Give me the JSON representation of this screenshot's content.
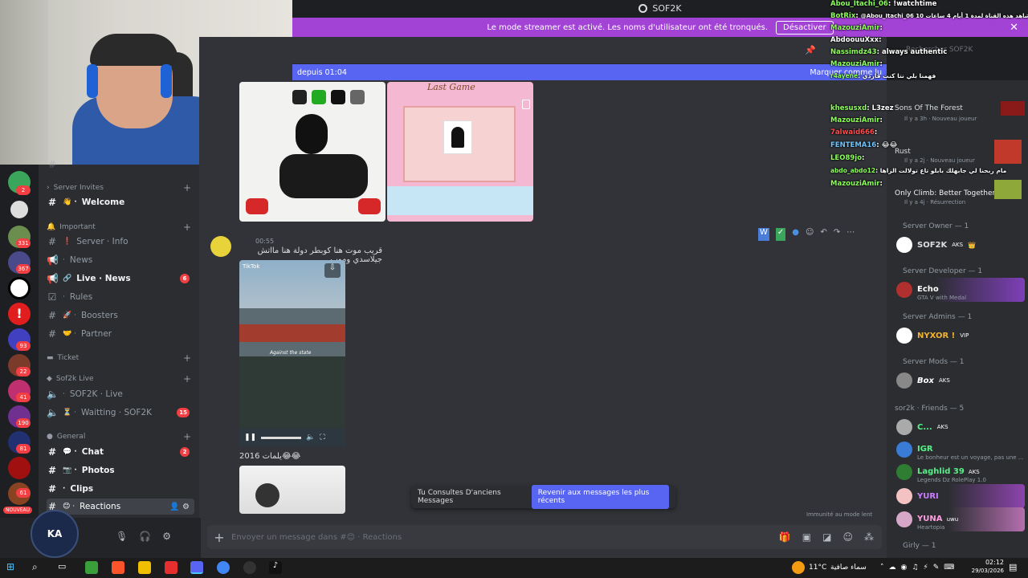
{
  "window": {
    "title": "SOF2K"
  },
  "streamer_banner": {
    "text": "Le mode streamer est activé. Les noms d'utilisateur ont été tronqués.",
    "button": "Désactiver"
  },
  "new_messages_bar": {
    "left": "depuis 01:04",
    "right": "Marquer comme lu"
  },
  "server_badges": [
    "2",
    "331",
    "367",
    "93",
    "22",
    "41",
    "190",
    "81",
    "61",
    "NOUVEAU"
  ],
  "channels": {
    "categories": [
      {
        "label": "Server Invites"
      },
      {
        "label": "Important"
      },
      {
        "label": "Ticket"
      },
      {
        "label": "Sof2k Live"
      },
      {
        "label": "General"
      }
    ],
    "items": [
      {
        "label": "Welcome"
      },
      {
        "label": "Server · Info"
      },
      {
        "label": "News"
      },
      {
        "label": "Live · News",
        "badge": "6"
      },
      {
        "label": "Rules"
      },
      {
        "label": "Boosters"
      },
      {
        "label": "Partner"
      },
      {
        "label": "SOF2K · Live"
      },
      {
        "label": "Waitting · SOF2K",
        "badge": "15"
      },
      {
        "label": "Chat",
        "badge": "2"
      },
      {
        "label": "Photos"
      },
      {
        "label": "Clips"
      },
      {
        "label": "Reactions"
      }
    ]
  },
  "messages": [
    {
      "time": "00:55",
      "text": "قريب موت هنا كوبطر دولة هنا مااتش جيلاسدي وموب"
    },
    {
      "video_label": "TikTok",
      "video_caption": "Against the state"
    },
    {
      "text": "يلمات 2016😂😂"
    }
  ],
  "game_card": {
    "title": "Last Game"
  },
  "jump_pill": {
    "text": "Tu Consultes D'anciens Messages",
    "button": "Revenir aux messages les plus récents"
  },
  "composer": {
    "placeholder": "Envoyer un message dans #😊 · Reactions"
  },
  "immunity_note": "Immunité au mode lent",
  "search": {
    "placeholder": "Rechercher SOF2K"
  },
  "activity": [
    {
      "title": "Sons Of The Forest",
      "sub": "Il y a 3h · Nouveau joueur"
    },
    {
      "title": "Rust",
      "sub": "Il y a 2j · Nouveau joueur"
    },
    {
      "title": "Only Climb: Better Together",
      "sub": "Il y a 4j · Résurrection"
    }
  ],
  "members": {
    "groups": [
      {
        "label": "Server Owner — 1"
      },
      {
        "label": "Server Developer — 1"
      },
      {
        "label": "Server Admins — 1"
      },
      {
        "label": "Server Mods — 1"
      },
      {
        "label": "sor2k · Friends — 5"
      },
      {
        "label": "Girly — 1"
      }
    ],
    "list": [
      {
        "name": "SOF2K",
        "tag": "AKS",
        "status": "",
        "color": "#dbdee1"
      },
      {
        "name": "Echo",
        "tag": "",
        "status": "GTA V with Medal",
        "color": "#ffffff"
      },
      {
        "name": "NYXOR !",
        "tag": "VIP",
        "status": "",
        "color": "#f0b232"
      },
      {
        "name": "Box",
        "tag": "AKS",
        "status": "",
        "color": "#ffffff"
      },
      {
        "name": "C...",
        "tag": "AKS",
        "status": "",
        "color": "#57f287"
      },
      {
        "name": "IGR",
        "tag": "",
        "status": "Le bonheur est un voyage, pas une ...",
        "color": "#57f287"
      },
      {
        "name": "Laghlid 39",
        "tag": "AKS",
        "status": "Legends Dz RolePlay 1.0",
        "color": "#57f287"
      },
      {
        "name": "YURI",
        "tag": "",
        "status": "",
        "color": "#c97dff"
      },
      {
        "name": "YUNA",
        "tag": "uwu",
        "status": "Heartopia",
        "color": "#ff9ee0"
      }
    ]
  },
  "twitch_chat": [
    {
      "user": "Abou_Itachi_06",
      "msg": "!watchtime"
    },
    {
      "user": "BotRix",
      "msg": "@Abou_Itachi_06 شاهد هذه القناة لمدة 1 أيام 4 ساعات 10 min"
    },
    {
      "user": "MazouziAmir",
      "msg": ""
    },
    {
      "user": "AbdoouuXxx",
      "msg": ""
    },
    {
      "user": "Nassimdz43",
      "msg": "always authentic"
    },
    {
      "user": "MazouziAmir",
      "msg": ""
    },
    {
      "user": "r4ayene",
      "msg": "فهمنا بلي نتا كنت قاردي"
    },
    {
      "user": "khesusxd",
      "msg": "L3zez"
    },
    {
      "user": "MazouziAmir",
      "msg": ""
    },
    {
      "user": "7alwaid666",
      "msg": ""
    },
    {
      "user": "FENTEMA16",
      "msg": "😂😂"
    },
    {
      "user": "LEO89jo",
      "msg": ""
    },
    {
      "user": "abdo_abdo12",
      "msg": "مام ربحنا لي جابهلك بابلو تاع تولالت الزاها"
    },
    {
      "user": "MazouziAmir",
      "msg": ""
    }
  ],
  "taskbar": {
    "weather": "11°C",
    "weather_text": "سماء صافية",
    "time": "02:12",
    "date": "29/03/2026"
  },
  "colors": {
    "accent": "#5865f2",
    "banner": "#a243d6",
    "badge": "#f23f43"
  }
}
